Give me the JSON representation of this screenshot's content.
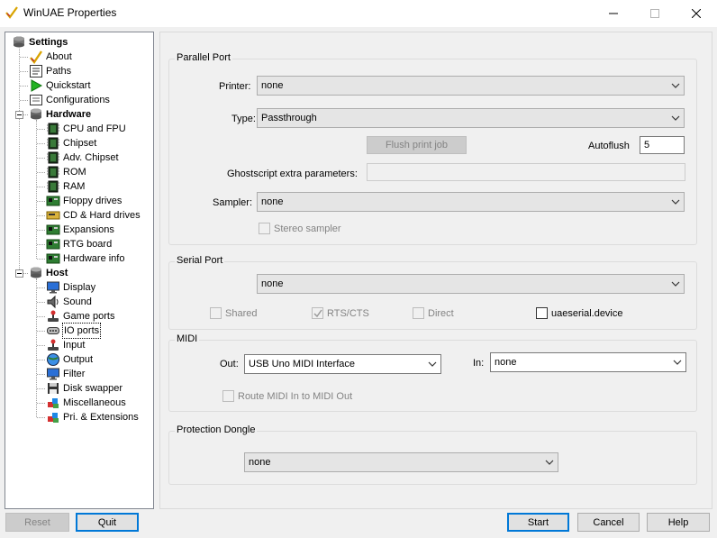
{
  "window": {
    "title": "WinUAE Properties"
  },
  "tree": {
    "root": "Settings",
    "items": [
      {
        "label": "About",
        "level": 1,
        "icon": "about-icon"
      },
      {
        "label": "Paths",
        "level": 1,
        "icon": "paths-icon"
      },
      {
        "label": "Quickstart",
        "level": 1,
        "icon": "quickstart-icon"
      },
      {
        "label": "Configurations",
        "level": 1,
        "icon": "configurations-icon"
      },
      {
        "label": "Hardware",
        "level": 1,
        "icon": "hardware-icon",
        "bold": true
      },
      {
        "label": "CPU and FPU",
        "level": 2,
        "icon": "chip-icon"
      },
      {
        "label": "Chipset",
        "level": 2,
        "icon": "chip-icon"
      },
      {
        "label": "Adv. Chipset",
        "level": 2,
        "icon": "chip-icon"
      },
      {
        "label": "ROM",
        "level": 2,
        "icon": "chip-icon"
      },
      {
        "label": "RAM",
        "level": 2,
        "icon": "chip-icon"
      },
      {
        "label": "Floppy drives",
        "level": 2,
        "icon": "board-icon"
      },
      {
        "label": "CD & Hard drives",
        "level": 2,
        "icon": "drive-icon"
      },
      {
        "label": "Expansions",
        "level": 2,
        "icon": "board-icon"
      },
      {
        "label": "RTG board",
        "level": 2,
        "icon": "board-icon"
      },
      {
        "label": "Hardware info",
        "level": 2,
        "icon": "board-icon"
      },
      {
        "label": "Host",
        "level": 1,
        "icon": "host-icon",
        "bold": true
      },
      {
        "label": "Display",
        "level": 2,
        "icon": "monitor-icon"
      },
      {
        "label": "Sound",
        "level": 2,
        "icon": "speaker-icon"
      },
      {
        "label": "Game ports",
        "level": 2,
        "icon": "joystick-icon"
      },
      {
        "label": "IO ports",
        "level": 2,
        "icon": "io-ports-icon",
        "selected": true
      },
      {
        "label": "Input",
        "level": 2,
        "icon": "joystick-icon"
      },
      {
        "label": "Output",
        "level": 2,
        "icon": "globe-icon"
      },
      {
        "label": "Filter",
        "level": 2,
        "icon": "monitor-icon"
      },
      {
        "label": "Disk swapper",
        "level": 2,
        "icon": "floppy-icon"
      },
      {
        "label": "Miscellaneous",
        "level": 2,
        "icon": "misc-icon"
      },
      {
        "label": "Pri. & Extensions",
        "level": 2,
        "icon": "misc-icon"
      }
    ]
  },
  "parallel": {
    "title": "Parallel Port",
    "printer_label": "Printer:",
    "printer_value": "none",
    "type_label": "Type:",
    "type_value": "Passthrough",
    "flush_label": "Flush print job",
    "autoflush_label": "Autoflush",
    "autoflush_value": "5",
    "ghost_label": "Ghostscript extra parameters:",
    "ghost_value": "",
    "sampler_label": "Sampler:",
    "sampler_value": "none",
    "stereo_label": "Stereo sampler"
  },
  "serial": {
    "title": "Serial Port",
    "port_value": "none",
    "shared_label": "Shared",
    "rtscts_label": "RTS/CTS",
    "direct_label": "Direct",
    "uaeserial_label": "uaeserial.device"
  },
  "midi": {
    "title": "MIDI",
    "out_label": "Out:",
    "out_value": "USB Uno MIDI Interface",
    "in_label": "In:",
    "in_value": "none",
    "route_label": "Route MIDI In to MIDI Out"
  },
  "dongle": {
    "title": "Protection Dongle",
    "value": "none"
  },
  "footer": {
    "reset": "Reset",
    "quit": "Quit",
    "start": "Start",
    "cancel": "Cancel",
    "help": "Help"
  },
  "colors": {
    "accent": "#0078d7",
    "panel": "#f0f0f0",
    "disabled_text": "#838383"
  }
}
